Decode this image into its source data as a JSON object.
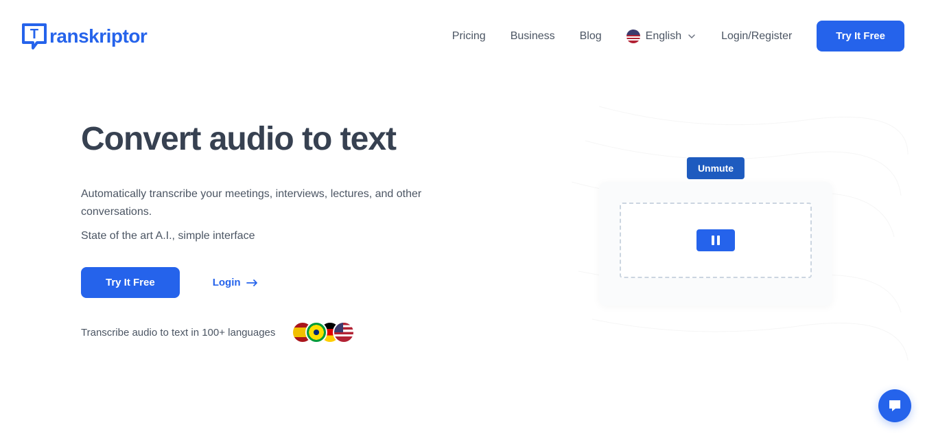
{
  "brand": {
    "name": "Transkriptor",
    "prefix_letter": "T",
    "suffix": "ranskriptor"
  },
  "nav": {
    "pricing": "Pricing",
    "business": "Business",
    "blog": "Blog",
    "language": "English",
    "login_register": "Login/Register",
    "try_free": "Try It Free"
  },
  "hero": {
    "headline": "Convert audio to text",
    "sub1": "Automatically transcribe your meetings, interviews, lectures, and other conversations.",
    "sub2": "State of the art A.I., simple interface",
    "cta_try": "Try It Free",
    "cta_login": "Login",
    "lang_label": "Transcribe audio to text in 100+ languages"
  },
  "player": {
    "unmute": "Unmute"
  },
  "colors": {
    "primary": "#2563eb"
  }
}
